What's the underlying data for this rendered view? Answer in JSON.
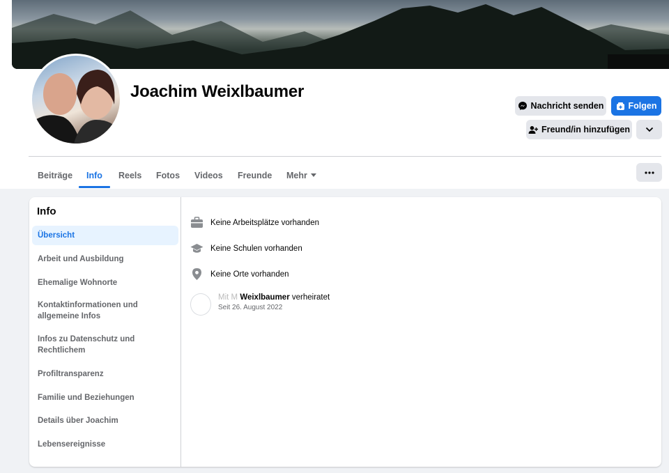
{
  "profile": {
    "name": "Joachim Weixlbaumer"
  },
  "actions": {
    "message_label": "Nachricht senden",
    "follow_label": "Folgen",
    "add_friend_label": "Freund/in hinzufügen"
  },
  "tabs": [
    {
      "label": "Beiträge",
      "active": false
    },
    {
      "label": "Info",
      "active": true
    },
    {
      "label": "Reels",
      "active": false
    },
    {
      "label": "Fotos",
      "active": false
    },
    {
      "label": "Videos",
      "active": false
    },
    {
      "label": "Freunde",
      "active": false
    },
    {
      "label": "Mehr",
      "active": false
    }
  ],
  "about": {
    "title": "Info",
    "nav": [
      {
        "label": "Übersicht",
        "active": true
      },
      {
        "label": "Arbeit und Ausbildung"
      },
      {
        "label": "Ehemalige Wohnorte"
      },
      {
        "label": "Kontaktinformationen und allgemeine Infos"
      },
      {
        "label": "Infos zu Datenschutz und Rechtlichem"
      },
      {
        "label": "Profiltransparenz"
      },
      {
        "label": "Familie und Beziehungen"
      },
      {
        "label": "Details über Joachim"
      },
      {
        "label": "Lebensereignisse"
      }
    ],
    "overview": {
      "work": "Keine Arbeitsplätze vorhanden",
      "school": "Keine Schulen vorhanden",
      "places": "Keine Orte vorhanden",
      "relationship_prefix": "Mit M    ",
      "relationship_name": "Weixlbaumer",
      "relationship_suffix": " verheiratet",
      "relationship_since": "Seit 26. August 2022"
    }
  },
  "colors": {
    "accent": "#1b74e4",
    "background": "#f0f2f5",
    "secondary_text": "#65676b",
    "button_grey": "#e4e6eb"
  }
}
